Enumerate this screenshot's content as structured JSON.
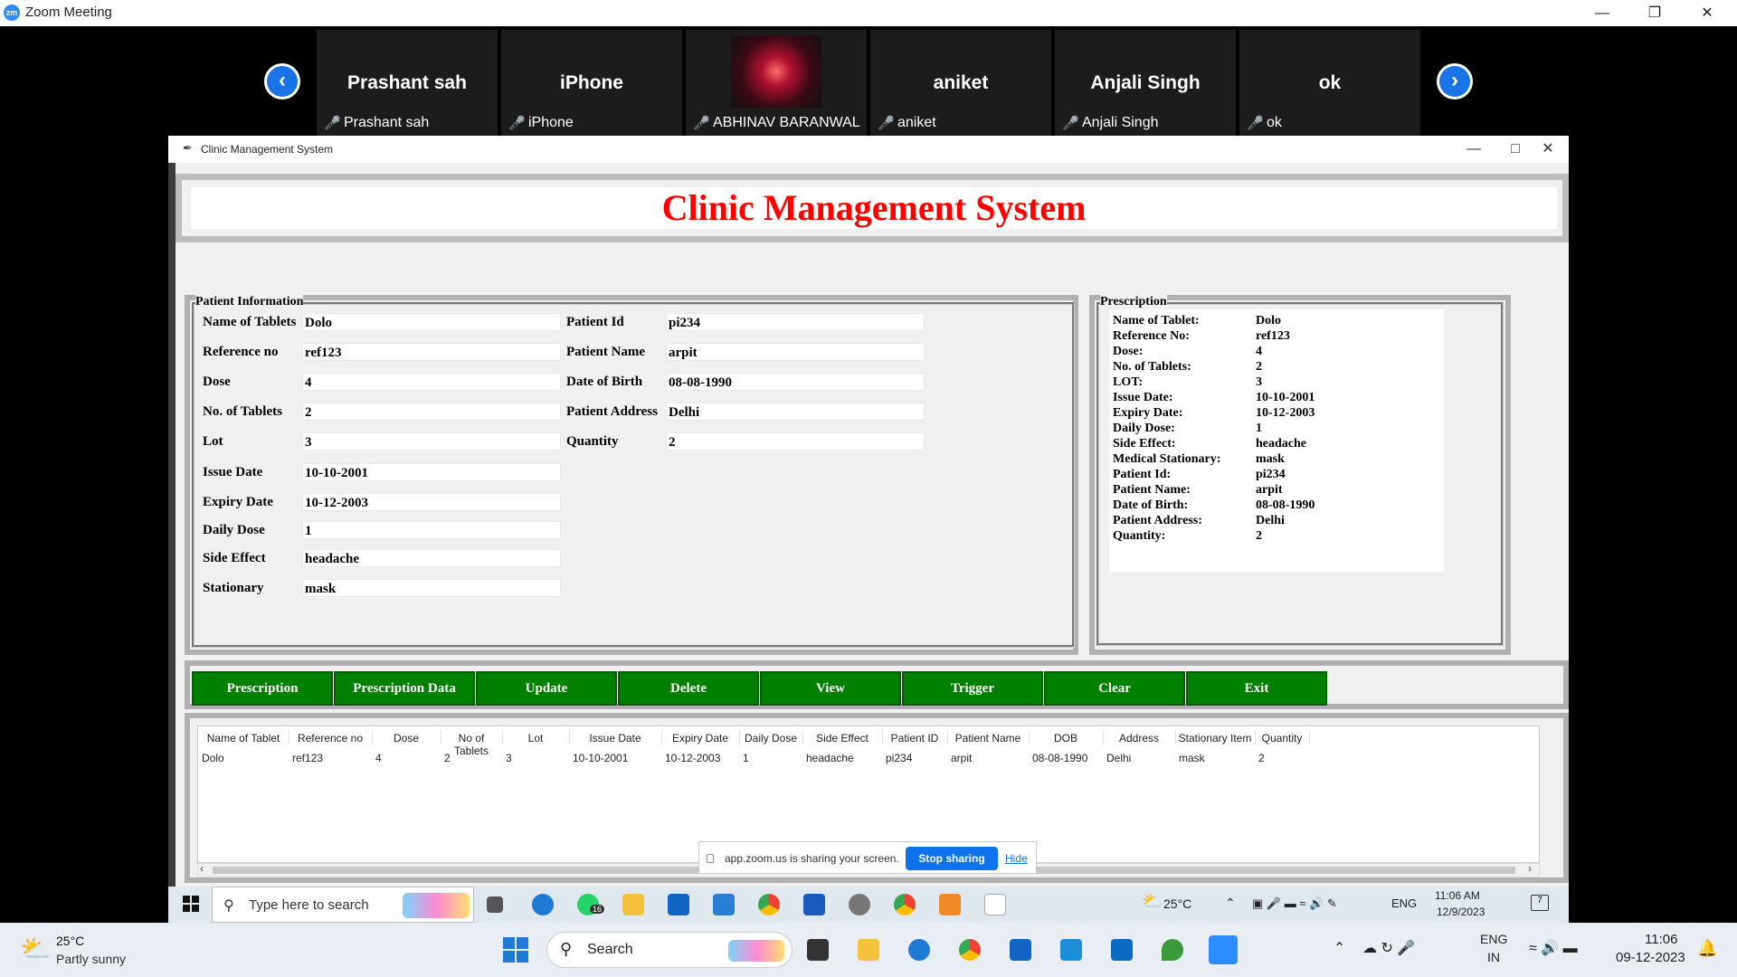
{
  "zoom": {
    "title": "Zoom Meeting",
    "logo": "zm"
  },
  "participants": [
    {
      "big": "Prashant sah",
      "label": "Prashant sah"
    },
    {
      "big": "iPhone",
      "label": "iPhone"
    },
    {
      "big": "",
      "label": "ABHINAV BARANWAL"
    },
    {
      "big": "aniket",
      "label": "aniket"
    },
    {
      "big": "Anjali Singh",
      "label": "Anjali Singh"
    },
    {
      "big": "ok",
      "label": "ok"
    }
  ],
  "app": {
    "window_title": "Clinic Management System",
    "heading": "Clinic Management System",
    "patient_info_title": "Patient Information",
    "prescription_title": "Prescription"
  },
  "form": {
    "left": [
      {
        "label": "Name of Tablets",
        "value": "Dolo"
      },
      {
        "label": "Reference no",
        "value": "ref123"
      },
      {
        "label": "Dose",
        "value": "4"
      },
      {
        "label": "No. of Tablets",
        "value": "2"
      },
      {
        "label": "Lot",
        "value": "3"
      },
      {
        "label": "Issue Date",
        "value": "10-10-2001"
      },
      {
        "label": "Expiry Date",
        "value": "10-12-2003"
      },
      {
        "label": "Daily Dose",
        "value": "1"
      },
      {
        "label": "Side Effect",
        "value": "headache"
      },
      {
        "label": "Stationary",
        "value": "mask"
      }
    ],
    "right": [
      {
        "label": "Patient Id",
        "value": "pi234"
      },
      {
        "label": "Patient Name",
        "value": "arpit"
      },
      {
        "label": "Date of Birth",
        "value": "08-08-1990"
      },
      {
        "label": "Patient Address",
        "value": "Delhi"
      },
      {
        "label": "Quantity",
        "value": "2"
      }
    ]
  },
  "prescription": [
    {
      "k": "Name of Tablet:",
      "v": "Dolo"
    },
    {
      "k": "Reference No:",
      "v": "ref123"
    },
    {
      "k": "Dose:",
      "v": "4"
    },
    {
      "k": "No. of Tablets:",
      "v": "2"
    },
    {
      "k": "LOT:",
      "v": "3"
    },
    {
      "k": "Issue Date:",
      "v": "10-10-2001"
    },
    {
      "k": "Expiry Date:",
      "v": "10-12-2003"
    },
    {
      "k": "Daily Dose:",
      "v": "1"
    },
    {
      "k": "Side Effect:",
      "v": "headache"
    },
    {
      "k": "Medical Stationary:",
      "v": "mask"
    },
    {
      "k": "Patient Id:",
      "v": "pi234"
    },
    {
      "k": "Patient Name:",
      "v": "arpit"
    },
    {
      "k": "Date of Birth:",
      "v": "08-08-1990"
    },
    {
      "k": "Patient Address:",
      "v": "Delhi"
    },
    {
      "k": "Quantity:",
      "v": "2"
    }
  ],
  "buttons": [
    "Prescription",
    "Prescription Data",
    "Update",
    "Delete",
    "View",
    "Trigger",
    "Clear",
    "Exit"
  ],
  "table": {
    "headers": [
      "Name of Tablet",
      "Reference no",
      "Dose",
      "No of Tablets",
      "Lot",
      "Issue Date",
      "Expiry Date",
      "Daily Dose",
      "Side Effect",
      "Patient ID",
      "Patient Name",
      "DOB",
      "Address",
      "Stationary Item",
      "Quantity"
    ],
    "rows": [
      [
        "Dolo",
        "ref123",
        "4",
        "2",
        "3",
        "10-10-2001",
        "10-12-2003",
        "1",
        "headache",
        "pi234",
        "arpit",
        "08-08-1990",
        "Delhi",
        "mask",
        "2"
      ]
    ]
  },
  "share": {
    "text": "app.zoom.us is sharing your screen.",
    "stop": "Stop sharing",
    "hide": "Hide"
  },
  "inner_taskbar": {
    "search_placeholder": "Type here to search",
    "temp": "25°C",
    "lang": "ENG",
    "time": "11:06 AM",
    "date": "12/9/2023",
    "whatsapp_badge": "16",
    "notif": "7"
  },
  "outer_taskbar": {
    "weather_temp": "25°C",
    "weather_desc": "Partly sunny",
    "search": "Search",
    "lang1": "ENG",
    "lang2": "IN",
    "time": "11:06",
    "date": "09-12-2023"
  },
  "colors": {
    "heading_red": "#ff0000",
    "button_green": "#008000",
    "zoom_blue": "#1a73e8"
  }
}
